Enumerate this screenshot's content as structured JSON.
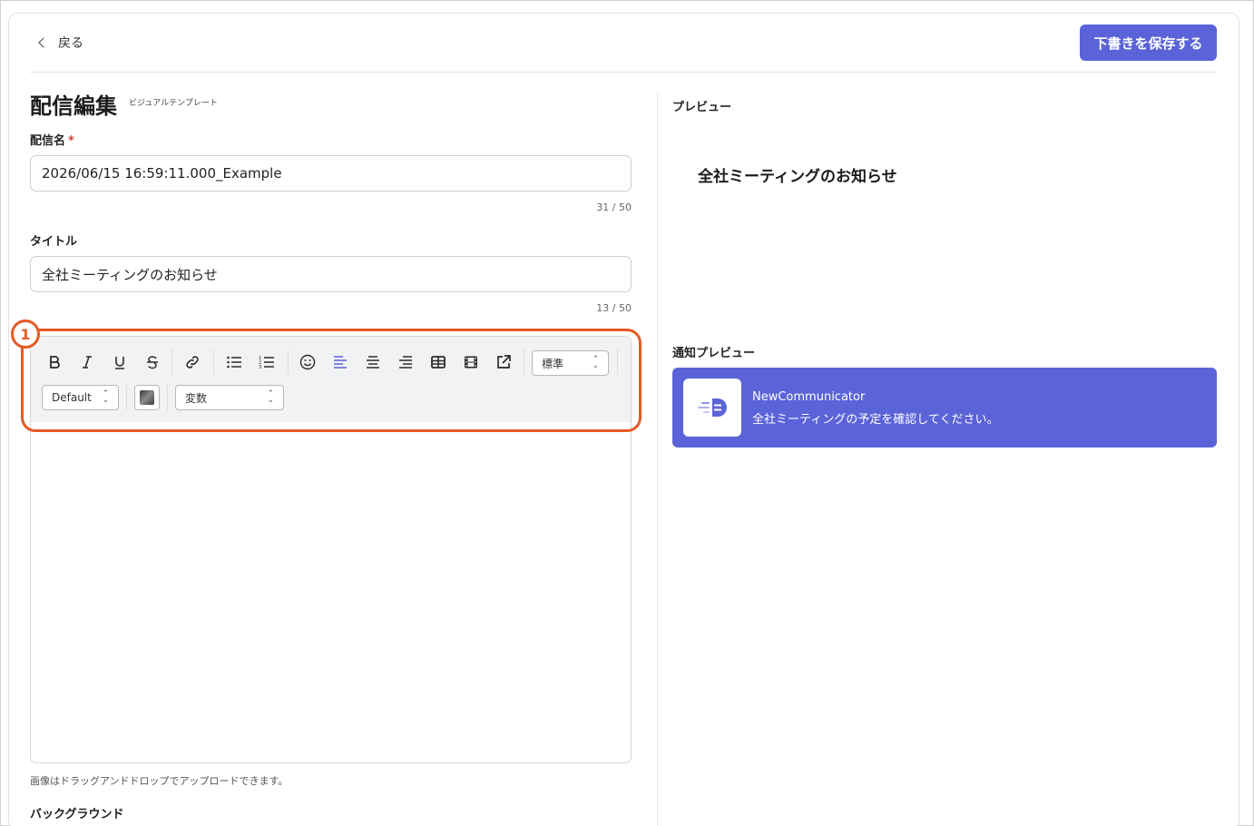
{
  "header": {
    "back_label": "戻る",
    "save_label": "下書きを保存する"
  },
  "page": {
    "title": "配信編集",
    "subtitle": "ビジュアルテンプレート"
  },
  "form": {
    "name_label": "配信名",
    "name_required": "*",
    "name_value": "2026/06/15 16:59:11.000_Example",
    "name_counter": "31 / 50",
    "title_label": "タイトル",
    "title_value": "全社ミーティングのお知らせ",
    "title_counter": "13 / 50",
    "upload_hint": "画像はドラッグアンドドロップでアップロードできます。",
    "background_label": "バックグラウンド"
  },
  "annotation": {
    "badge": "1",
    "color": "#e55a25"
  },
  "toolbar": {
    "buttons": [
      "bold-icon",
      "italic-icon",
      "underline-icon",
      "strikethrough-icon",
      "link-icon",
      "bullet-list-icon",
      "numbered-list-icon",
      "emoji-icon",
      "align-left-icon",
      "align-center-icon",
      "align-right-icon",
      "table-icon",
      "video-icon",
      "external-link-icon"
    ],
    "size_select": "標準",
    "font_select": "Default",
    "variable_select": "変数"
  },
  "preview": {
    "label": "プレビュー",
    "title": "全社ミーティングのお知らせ"
  },
  "notification": {
    "label": "通知プレビュー",
    "app_name": "NewCommunicator",
    "message": "全社ミーティングの予定を確認してください。",
    "bg_color": "#5b63d8"
  },
  "colors": {
    "accent": "#5b63d8",
    "active_align": "#5b63d8"
  }
}
